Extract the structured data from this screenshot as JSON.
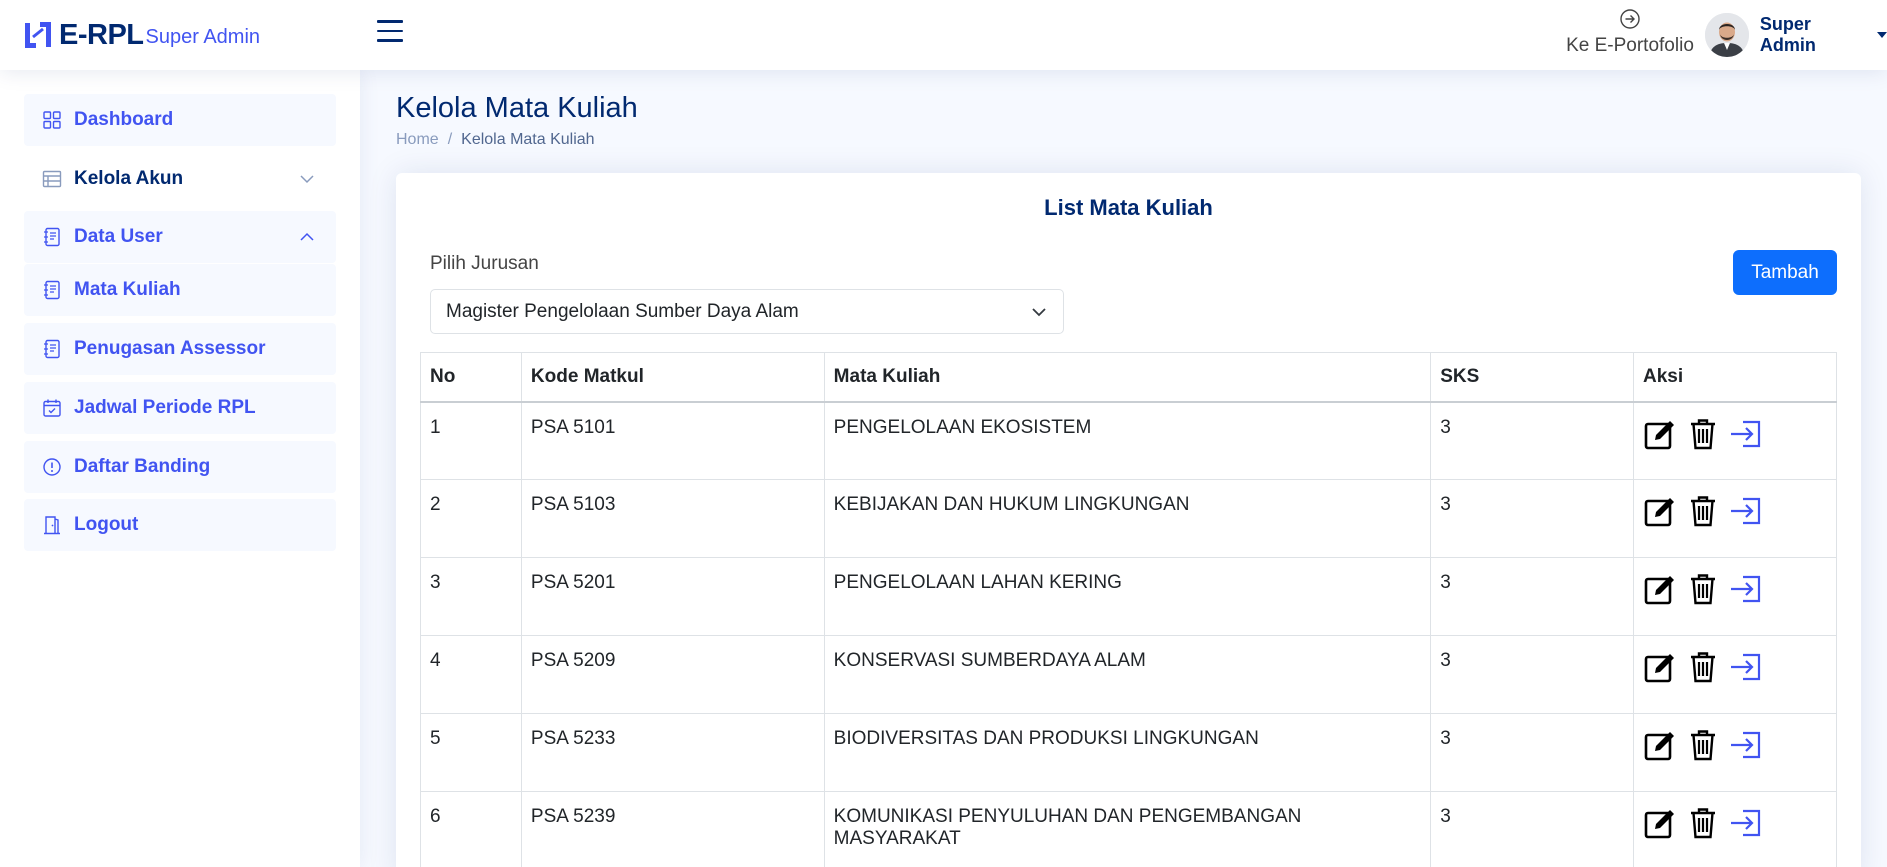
{
  "header": {
    "logo_text": "E-RPL",
    "logo_sub": "Super Admin",
    "eportfolio_label": "Ke E-Portofolio",
    "profile_name": "Super Admin"
  },
  "sidebar": {
    "items": [
      {
        "label": "Dashboard",
        "icon": "grid-icon"
      },
      {
        "label": "Kelola Akun",
        "icon": "layout-icon"
      },
      {
        "label": "Data User",
        "icon": "journal-icon"
      },
      {
        "label": "Mata Kuliah",
        "icon": "journal-icon"
      },
      {
        "label": "Penugasan Assessor",
        "icon": "journal-icon"
      },
      {
        "label": "Jadwal Periode RPL",
        "icon": "calendar-check-icon"
      },
      {
        "label": "Daftar Banding",
        "icon": "exclamation-circle-icon"
      },
      {
        "label": "Logout",
        "icon": "door-icon"
      }
    ]
  },
  "page": {
    "title": "Kelola Mata Kuliah",
    "breadcrumb_home": "Home",
    "breadcrumb_sep": "/",
    "breadcrumb_current": "Kelola Mata Kuliah"
  },
  "card": {
    "title": "List Mata Kuliah",
    "select_label": "Pilih Jurusan",
    "select_value": "Magister Pengelolaan Sumber Daya Alam",
    "add_button": "Tambah"
  },
  "table": {
    "headers": [
      "No",
      "Kode Matkul",
      "Mata Kuliah",
      "SKS",
      "Aksi"
    ],
    "rows": [
      {
        "no": "1",
        "kode": "PSA 5101",
        "matkul": "PENGELOLAAN EKOSISTEM",
        "sks": "3"
      },
      {
        "no": "2",
        "kode": "PSA 5103",
        "matkul": "KEBIJAKAN DAN HUKUM LINGKUNGAN",
        "sks": "3"
      },
      {
        "no": "3",
        "kode": "PSA 5201",
        "matkul": "PENGELOLAAN LAHAN KERING",
        "sks": "3"
      },
      {
        "no": "4",
        "kode": "PSA 5209",
        "matkul": "KONSERVASI SUMBERDAYA ALAM",
        "sks": "3"
      },
      {
        "no": "5",
        "kode": "PSA 5233",
        "matkul": "BIODIVERSITAS DAN PRODUKSI LINGKUNGAN",
        "sks": "3"
      },
      {
        "no": "6",
        "kode": "PSA 5239",
        "matkul": "KOMUNIKASI PENYULUHAN DAN PENGEMBANGAN MASYARAKAT",
        "sks": "3"
      }
    ],
    "action_icons": [
      "edit-icon",
      "trash-icon",
      "enter-icon"
    ]
  },
  "colors": {
    "brand": "#4154f1",
    "navy": "#012970",
    "primary_button": "#0d6efd",
    "background": "#f6f9ff"
  }
}
